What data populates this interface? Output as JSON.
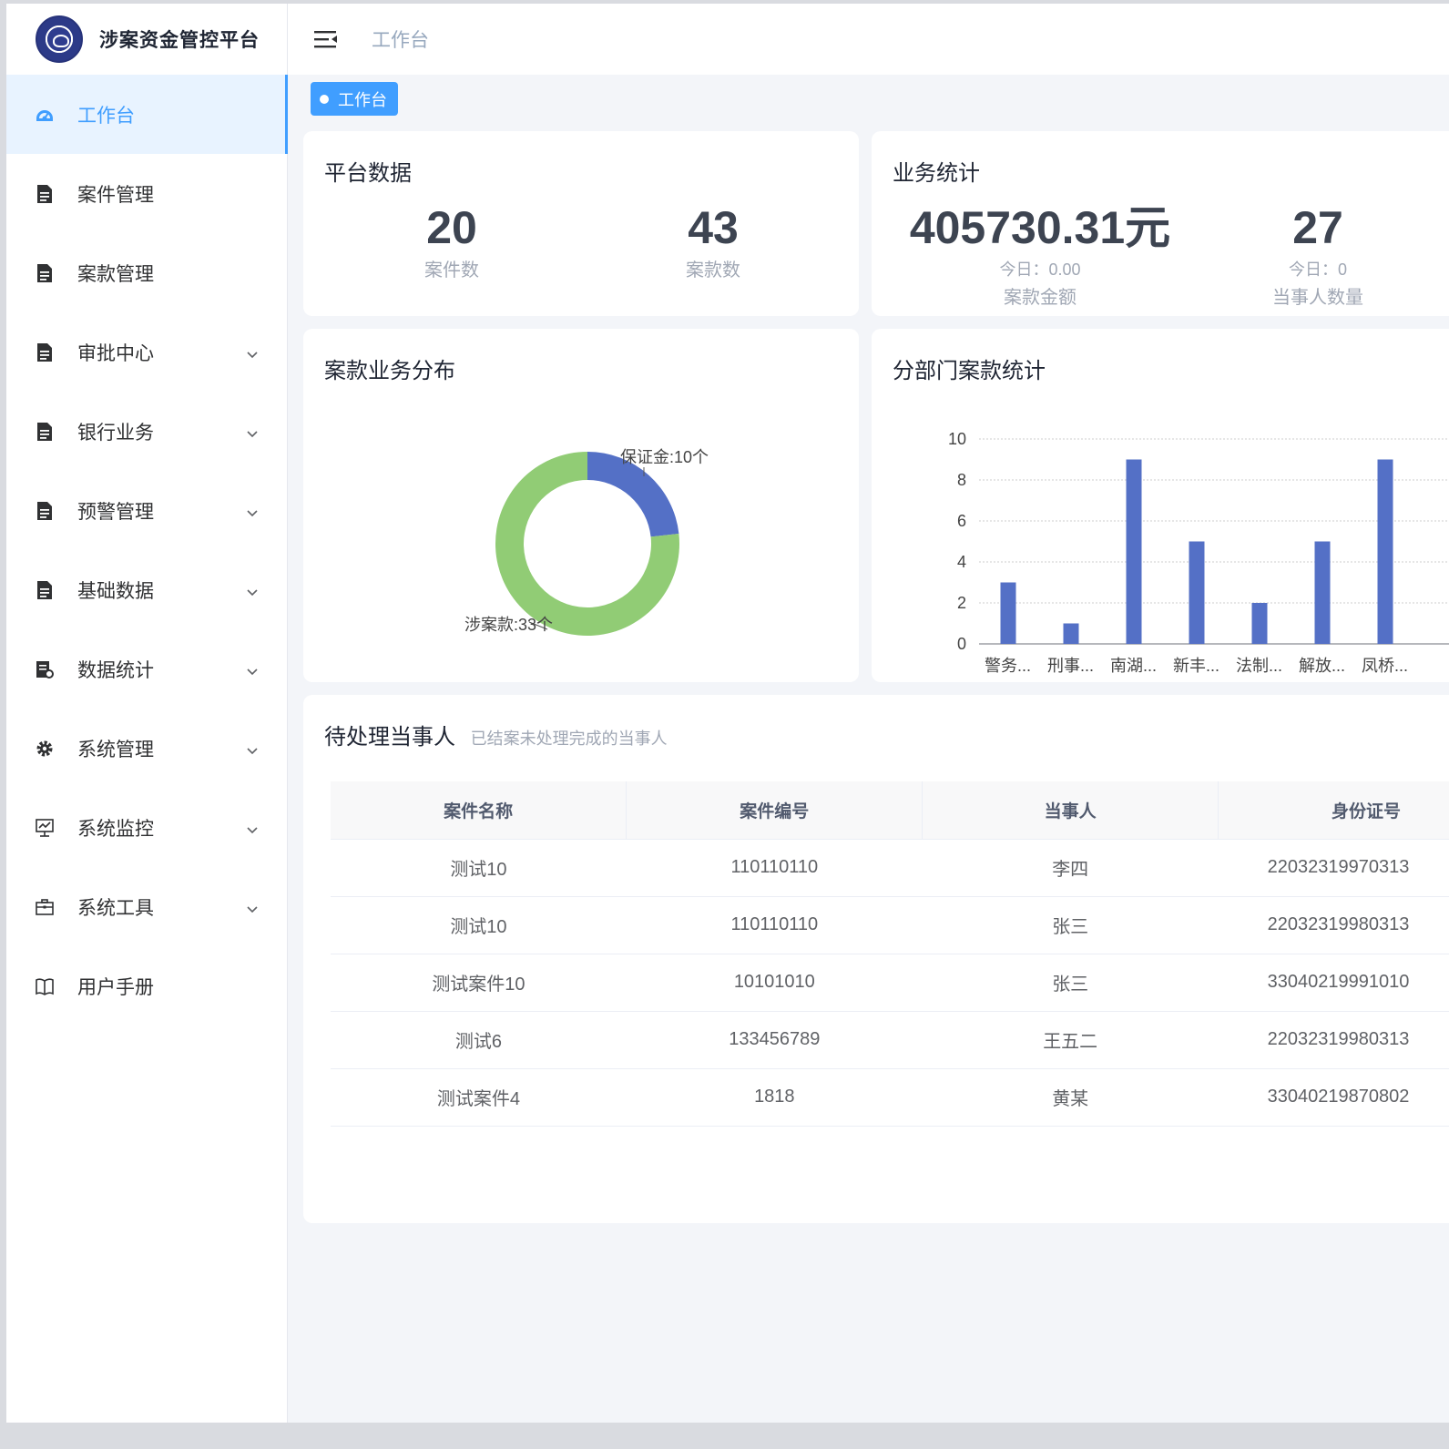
{
  "app": {
    "title": "涉案资金管控平台"
  },
  "header": {
    "breadcrumb": "工作台"
  },
  "tags": [
    {
      "label": "工作台"
    }
  ],
  "sidebar": {
    "items": [
      {
        "label": "工作台",
        "icon": "dashboard-icon",
        "active": true,
        "has_children": false
      },
      {
        "label": "案件管理",
        "icon": "document-icon",
        "has_children": false
      },
      {
        "label": "案款管理",
        "icon": "document-icon",
        "has_children": false
      },
      {
        "label": "审批中心",
        "icon": "document-icon",
        "has_children": true
      },
      {
        "label": "银行业务",
        "icon": "document-icon",
        "has_children": true
      },
      {
        "label": "预警管理",
        "icon": "document-icon",
        "has_children": true
      },
      {
        "label": "基础数据",
        "icon": "document-icon",
        "has_children": true
      },
      {
        "label": "数据统计",
        "icon": "report-icon",
        "has_children": true
      },
      {
        "label": "系统管理",
        "icon": "gear-icon",
        "has_children": true
      },
      {
        "label": "系统监控",
        "icon": "monitor-icon",
        "has_children": true
      },
      {
        "label": "系统工具",
        "icon": "toolbox-icon",
        "has_children": true
      },
      {
        "label": "用户手册",
        "icon": "book-icon",
        "has_children": false
      }
    ]
  },
  "platform": {
    "title": "平台数据",
    "case_count": {
      "value": "20",
      "label": "案件数"
    },
    "fund_count": {
      "value": "43",
      "label": "案款数"
    }
  },
  "business": {
    "title": "业务统计",
    "amount": {
      "value": "405730.31元",
      "today": "今日：0.00",
      "label": "案款金额"
    },
    "parties": {
      "value": "27",
      "today": "今日：0",
      "label": "当事人数量"
    }
  },
  "distribution": {
    "title": "案款业务分布",
    "chart_data": {
      "type": "pie",
      "slices": [
        {
          "name": "保证金",
          "value": 10,
          "label": "保证金:10个",
          "color": "#5470c6"
        },
        {
          "name": "涉案款",
          "value": 33,
          "label": "涉案款:33个",
          "color": "#91cc75"
        }
      ]
    }
  },
  "department": {
    "title": "分部门案款统计",
    "chart_data": {
      "type": "bar",
      "categories": [
        "警务...",
        "刑事...",
        "南湖...",
        "新丰...",
        "法制...",
        "解放...",
        "凤桥..."
      ],
      "values": [
        3,
        1,
        9,
        5,
        2,
        5,
        9
      ],
      "ylim": [
        0,
        10
      ],
      "yticks": [
        "0",
        "2",
        "4",
        "6",
        "8",
        "10"
      ],
      "color": "#5470c6"
    }
  },
  "pending": {
    "title": "待处理当事人",
    "subtitle": "已结案未处理完成的当事人",
    "columns": [
      "案件名称",
      "案件编号",
      "当事人",
      "身份证号"
    ],
    "rows": [
      [
        "测试10",
        "110110110",
        "李四",
        "22032319970313"
      ],
      [
        "测试10",
        "110110110",
        "张三",
        "22032319980313"
      ],
      [
        "测试案件10",
        "10101010",
        "张三",
        "33040219991010"
      ],
      [
        "测试6",
        "133456789",
        "王五二",
        "22032319980313"
      ],
      [
        "测试案件4",
        "1818",
        "黄某",
        "33040219870802"
      ]
    ]
  }
}
